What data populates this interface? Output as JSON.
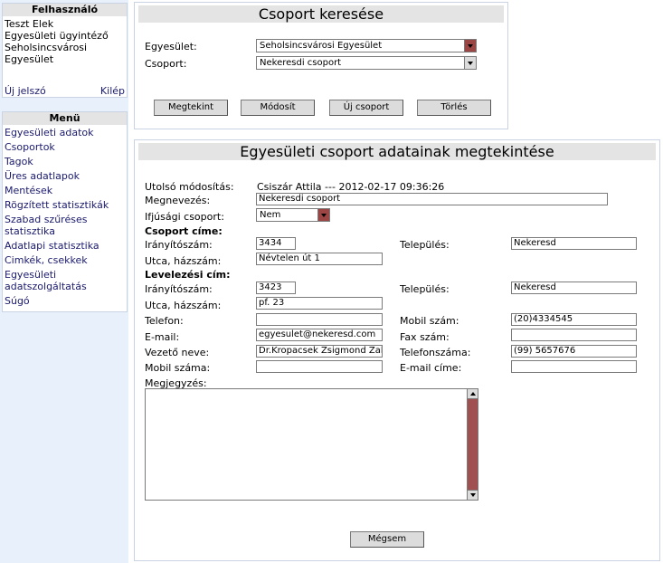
{
  "sidebar": {
    "user_box": {
      "title": "Felhasználó",
      "lines": [
        "Teszt Elek",
        "Egyesületi ügyintéző",
        "Seholsincsvárosi",
        "Egyesület"
      ],
      "password_link": "Új jelszó",
      "logout_link": "Kilép"
    },
    "menu_box": {
      "title": "Menü",
      "items": [
        "Egyesületi adatok",
        "Csoportok",
        "Tagok",
        "Üres adatlapok",
        "Mentések",
        "Rögzített statisztikák",
        "Szabad szűréses statisztika",
        "Adatlapi statisztika",
        "Cimkék, csekkek",
        "Egyesületi adatszolgáltatás",
        "Súgó"
      ]
    }
  },
  "search": {
    "title": "Csoport keresése",
    "association_label": "Egyesület:",
    "association_value": "Seholsincsvárosi Egyesület",
    "group_label": "Csoport:",
    "group_value": "Nekeresdi csoport",
    "buttons": {
      "view": "Megtekint",
      "modify": "Módosít",
      "new": "Új csoport",
      "delete": "Törlés"
    }
  },
  "details": {
    "title": "Egyesületi csoport adatainak megtekintése",
    "last_modified_label": "Utolsó módosítás:",
    "last_modified_value": "Csiszár Attila --- 2012-02-17 09:36:26",
    "name_label": "Megnevezés:",
    "name_value": "Nekeresdi csoport",
    "youth_label": "Ifjúsági csoport:",
    "youth_value": "Nem",
    "group_address_heading": "Csoport címe:",
    "postal_address_heading": "Levelezési cím:",
    "zip_label": "Irányítószám:",
    "city_label": "Település:",
    "street_label": "Utca, házszám:",
    "group_address": {
      "zip": "3434",
      "city": "Nekeresd",
      "street": "Névtelen út 1"
    },
    "postal_address": {
      "zip": "3423",
      "city": "Nekeresd",
      "street": "pf. 23"
    },
    "phone_label": "Telefon:",
    "phone_value": "",
    "mobile_label": "Mobil szám:",
    "mobile_value": "(20)4334545",
    "email_label": "E-mail:",
    "email_value": "egyesulet@nekeresd.com",
    "fax_label": "Fax szám:",
    "fax_value": "",
    "leader_label": "Vezető neve:",
    "leader_value": "Dr.Kropacsek Zsigmond Zakariás",
    "leader_phone_label": "Telefonszáma:",
    "leader_phone_value": "(99) 5657676",
    "leader_mobile_label": "Mobil száma:",
    "leader_mobile_value": "",
    "leader_email_label": "E-mail címe:",
    "leader_email_value": "",
    "notes_label": "Megjegyzés:",
    "notes_value": "",
    "cancel_button": "Mégsem"
  }
}
